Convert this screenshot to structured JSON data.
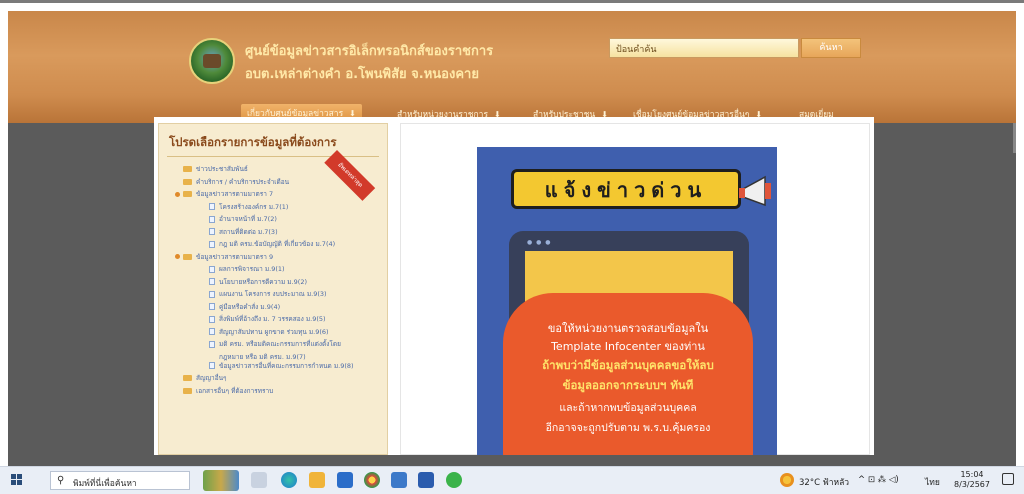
{
  "header": {
    "title_line1": "ศูนย์ข้อมูลข่าวสารอิเล็กทรอนิกส์ของราชการ",
    "title_line2": "อบต.เหล่าต่างคำ อ.โพนพิสัย จ.หนองคาย",
    "search_placeholder": "ป้อนคำค้น",
    "search_button": "ค้นหา"
  },
  "nav": {
    "items": [
      {
        "label": "เกี่ยวกับศูนย์ข้อมูลข่าวสาร",
        "active": true
      },
      {
        "label": "สำหรับหน่วยงานราชการ",
        "active": false
      },
      {
        "label": "สำหรับประชาชน",
        "active": false
      },
      {
        "label": "เชื่อมโยงศูนย์ข้อมูลข่าวสารอื่นๆ",
        "active": false
      },
      {
        "label": "สมุดเยี่ยม",
        "active": false
      }
    ],
    "arrow": "⬇"
  },
  "sidebar": {
    "title": "โปรดเลือกรายการข้อมูลที่ต้องการ",
    "ribbon": "อัพเดทล่าสุด",
    "tree": [
      {
        "level": 0,
        "type": "folder",
        "label": "ข่าวประชาสัมพันธ์"
      },
      {
        "level": 0,
        "type": "folder",
        "label": "คำบริการ / คำบริการประจำเดือน"
      },
      {
        "level": 0,
        "type": "folder-open",
        "label": "ข้อมูลข่าวสารตามมาตรา 7"
      },
      {
        "level": 1,
        "type": "file",
        "label": "โครงสร้างองค์กร ม.7(1)"
      },
      {
        "level": 1,
        "type": "file",
        "label": "อำนาจหน้าที่ ม.7(2)"
      },
      {
        "level": 1,
        "type": "file",
        "label": "สถานที่ติดต่อ ม.7(3)"
      },
      {
        "level": 1,
        "type": "file",
        "label": "กฎ มติ ครม.ข้อบัญญัติ ที่เกี่ยวข้อง ม.7(4)"
      },
      {
        "level": 0,
        "type": "folder-open",
        "label": "ข้อมูลข่าวสารตามมาตรา 9"
      },
      {
        "level": 1,
        "type": "file",
        "label": "ผลการพิจารณา ม.9(1)"
      },
      {
        "level": 1,
        "type": "file",
        "label": "นโยบายหรือการตีความ ม.9(2)"
      },
      {
        "level": 1,
        "type": "file",
        "label": "แผนงาน โครงการ งบประมาณ ม.9(3)"
      },
      {
        "level": 1,
        "type": "file",
        "label": "คู่มือหรือคำสั่ง ม.9(4)"
      },
      {
        "level": 1,
        "type": "file",
        "label": "สิ่งพิมพ์ที่อ้างถึง ม. 7 วรรคสอง ม.9(5)"
      },
      {
        "level": 1,
        "type": "file",
        "label": "สัญญาสัมปทาน ผูกขาด ร่วมทุน ม.9(6)"
      },
      {
        "level": 1,
        "type": "file",
        "label": "มติ ครม. หรือมติคณะกรรมการที่แต่งตั้งโดย"
      },
      {
        "level": 1,
        "type": "file-cont",
        "label": "กฎหมาย หรือ มติ ครม. ม.9(7)"
      },
      {
        "level": 1,
        "type": "file",
        "label": "ข้อมูลข่าวสารอื่นที่คณะกรรมการกำหนด ม.9(8)"
      },
      {
        "level": 0,
        "type": "folder",
        "label": "สัญญาอื่นๆ"
      },
      {
        "level": 0,
        "type": "folder",
        "label": "เอกสารอื่นๆ ที่ต้องการทราบ"
      }
    ]
  },
  "poster": {
    "banner": "แจ้งข่าวด่วน",
    "line1": "ขอให้หน่วยงานตรวจสอบข้อมูลใน",
    "line2": "Template Infocenter ของท่าน",
    "line3": "ถ้าพบว่ามีข้อมูลส่วนบุคคลขอให้ลบ",
    "line4": "ข้อมูลออกจากระบบฯ ทันที",
    "line5": "และถ้าหากพบข้อมูลส่วนบุคคล",
    "line6": "อีกอาจจะถูกปรับตาม พ.ร.บ.คุ้มครอง",
    "dots": "● ● ●"
  },
  "taskbar": {
    "search_placeholder": "พิมพ์ที่นี่เพื่อค้นหา",
    "weather": "32°C ฟ้าหลัว",
    "language": "ไทย",
    "time": "15:04",
    "date": "8/3/2567",
    "tray_icons": "^ ⊡ ⁂ ◁)"
  }
}
